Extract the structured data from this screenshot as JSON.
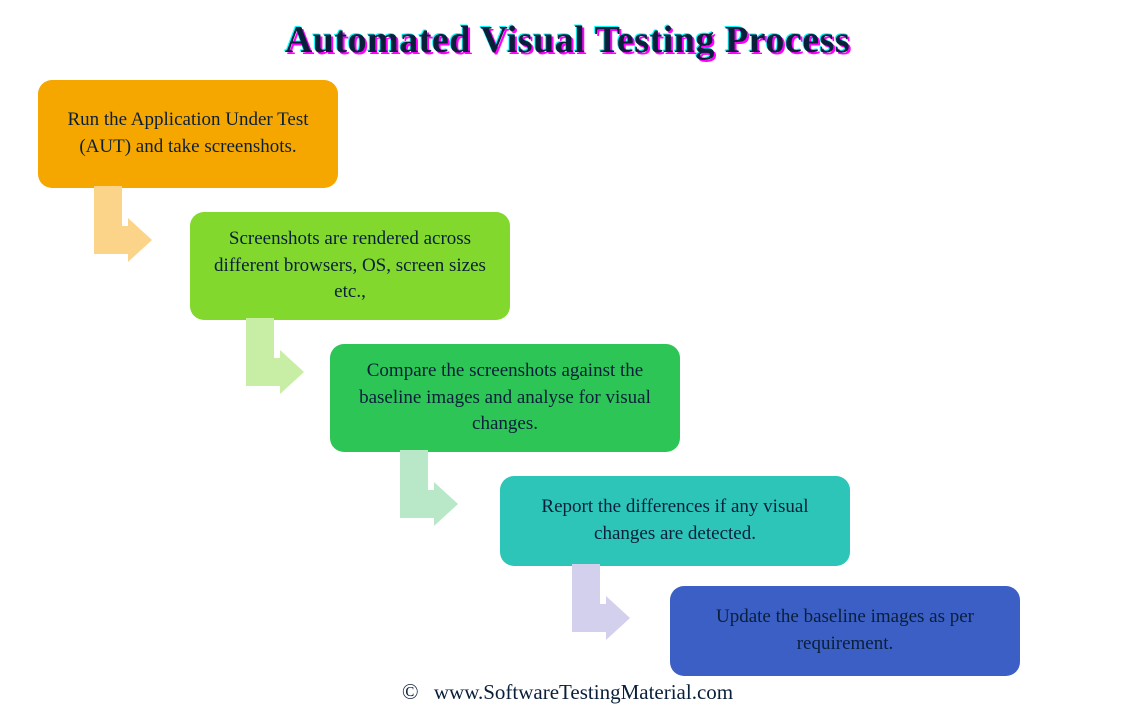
{
  "title": "Automated Visual Testing Process",
  "steps": [
    {
      "text": "Run the Application Under Test (AUT) and take screenshots.",
      "color": "#f5a700"
    },
    {
      "text": "Screenshots are rendered across different browsers, OS, screen sizes etc.,",
      "color": "#82d82d"
    },
    {
      "text": "Compare the screenshots against the baseline images and analyse for visual changes.",
      "color": "#2dc556"
    },
    {
      "text": "Report the differences if any visual changes are detected.",
      "color": "#2dc5b8"
    },
    {
      "text": "Update the baseline images as per requirement.",
      "color": "#3b5fc5"
    }
  ],
  "footer": {
    "copyright": "©",
    "site": "www.SoftwareTestingMaterial.com"
  },
  "arrow_colors": [
    "#fbd48a",
    "#c8eda5",
    "#b8e8c8",
    "#d3d0ed"
  ]
}
